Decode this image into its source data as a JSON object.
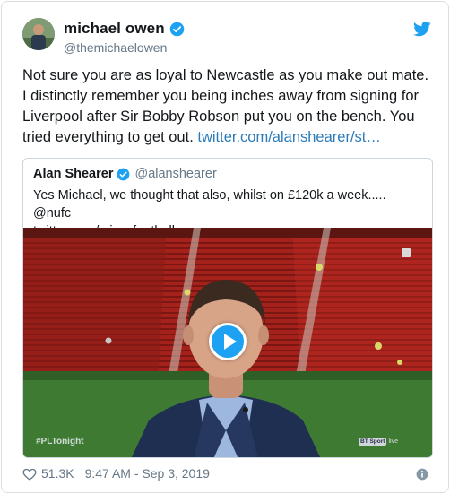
{
  "tweet": {
    "author_name": "michael owen",
    "author_handle": "@themichaelowen",
    "text": "Not sure you are as loyal to Newcastle as you make out mate. I distinctly remember you being inches away from signing for Liverpool after Sir Bobby Robson put you on the bench. You tried everything to get out. ",
    "link": "twitter.com/alanshearer/st…",
    "likes": "51.3K",
    "timestamp": "9:47 AM - Sep 3, 2019"
  },
  "quote": {
    "author_name": "Alan Shearer",
    "author_handle": "@alanshearer",
    "text_line1": "Yes Michael, we thought that also, whilst on £120k a week..... @nufc",
    "text_line2": "twitter.com/mirrorfootball…",
    "video_tag": "#PLTonight",
    "broadcaster": "BT Sport",
    "broadcaster_suffix": "live"
  },
  "icons": {
    "verified": "verified-badge-icon",
    "bird": "twitter-bird-icon",
    "heart": "heart-icon",
    "info": "info-icon",
    "play": "play-icon"
  },
  "colors": {
    "accent": "#1da1f2",
    "link": "#2b7bb9",
    "secondary_text": "#657786",
    "border": "#ccd6dd"
  }
}
